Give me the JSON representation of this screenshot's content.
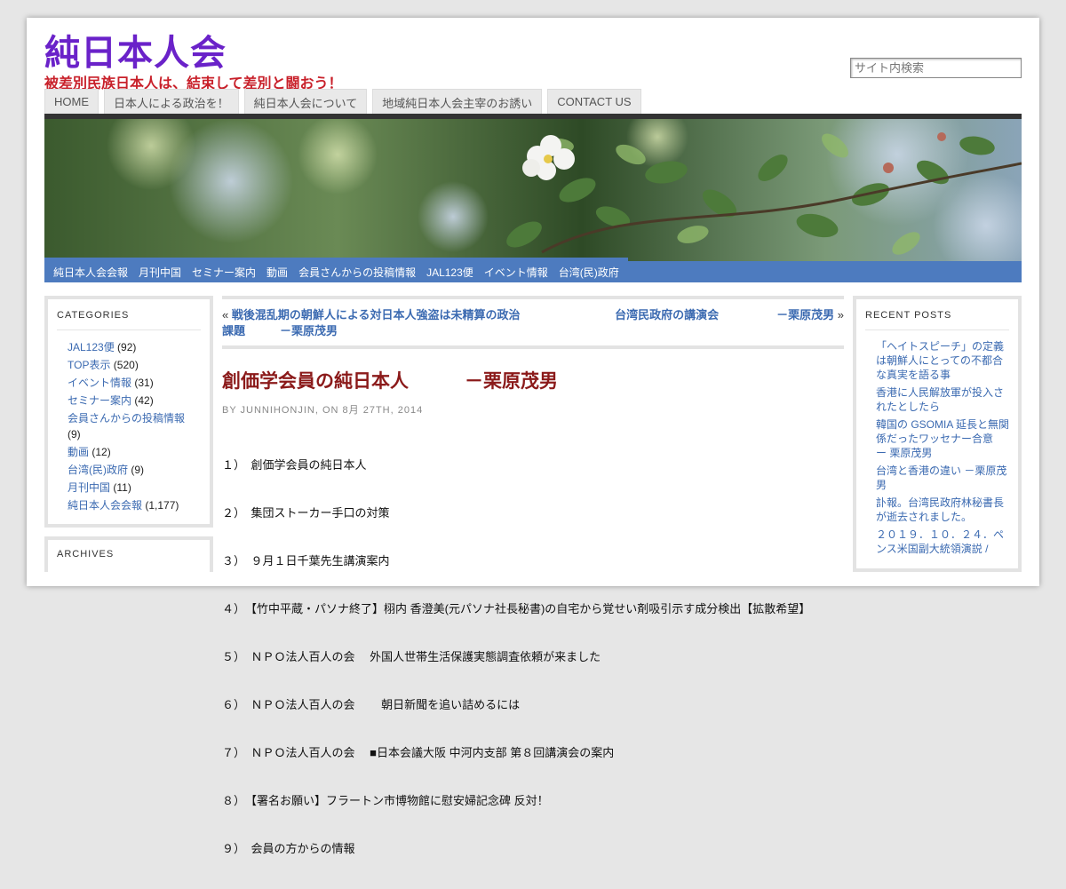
{
  "header": {
    "site_title": "純日本人会",
    "site_description": "被差別民族日本人は、結束して差別と闘おう！",
    "search_placeholder": "サイト内検索"
  },
  "top_tabs": [
    "HOME",
    "日本人による政治を！",
    "純日本人会について",
    "地域純日本人会主宰のお誘い",
    "CONTACT US"
  ],
  "nav_items": [
    "純日本人会会報",
    "月刊中国",
    "セミナー案内",
    "動画",
    "会員さんからの投稿情報",
    "JAL123便",
    "イベント情報",
    "台湾(民)政府"
  ],
  "sidebar_left": {
    "categories_title": "CATEGORIES",
    "categories": [
      {
        "name": "JAL123便",
        "count": "(92)"
      },
      {
        "name": "TOP表示",
        "count": "(520)"
      },
      {
        "name": "イベント情報",
        "count": "(31)"
      },
      {
        "name": "セミナー案内",
        "count": "(42)"
      },
      {
        "name": "会員さんからの投稿情報",
        "count": "(9)"
      },
      {
        "name": "動画",
        "count": "(12)"
      },
      {
        "name": "台湾(民)政府",
        "count": "(9)"
      },
      {
        "name": "月刊中国",
        "count": "(11)"
      },
      {
        "name": "純日本人会会報",
        "count": "(1,177)"
      }
    ],
    "archives_title": "ARCHIVES"
  },
  "post_nav": {
    "prev_arrow": "«",
    "prev_line1": "戦後混乱期の朝鮮人による対日本人強盗は未精算の政治",
    "prev_line2": "課題　　　－栗原茂男",
    "next_text": "台湾民政府の講演会　　　　　－栗原茂男",
    "next_arrow": "»"
  },
  "post": {
    "title": "創価学会員の純日本人　　　－栗原茂男",
    "meta": "BY JUNNIHONJIN, ON 8月 27TH, 2014",
    "items": [
      "１）　創価学会員の純日本人",
      "２）　集団ストーカー手口の対策",
      "３）　９月１日千葉先生講演案内",
      "４）　【竹中平蔵・パソナ終了】栩内 香澄美(元パソナ社長秘書)の自宅から覚せい剤吸引示す成分検出【拡散希望】",
      "５）　ＮＰＯ法人百人の会　 外国人世帯生活保護実態調査依頼が来ました",
      "６）　ＮＰＯ法人百人の会　　 朝日新聞を追い詰めるには",
      "７）　ＮＰＯ法人百人の会　 ■日本会議大阪 中河内支部 第８回講演会の案内",
      "８）　【署名お願い】フラートン市博物館に慰安婦記念碑 反対！",
      "９）　会員の方からの情報"
    ]
  },
  "sidebar_right": {
    "recent_title": "RECENT POSTS",
    "posts": [
      "「ヘイトスピーチ」の定義は朝鮮人にとっての不都合な真実を語る事",
      "香港に人民解放軍が投入されたとしたら",
      "韓国の GSOMIA 延長と無関係だったワッセナー合意　　　　ー 栗原茂男",
      "台湾と香港の違い －栗原茂男",
      "訃報。台湾民政府林秘書長が逝去されました。",
      "２０１９．１０．２４．ペンス米国副大統領演説 /"
    ]
  },
  "colors": {
    "title": "#6a22c9",
    "tagline": "#c8202a",
    "nav_bg": "#4d7bbf",
    "link": "#3b6ab1",
    "post_title": "#8b1a1a"
  }
}
